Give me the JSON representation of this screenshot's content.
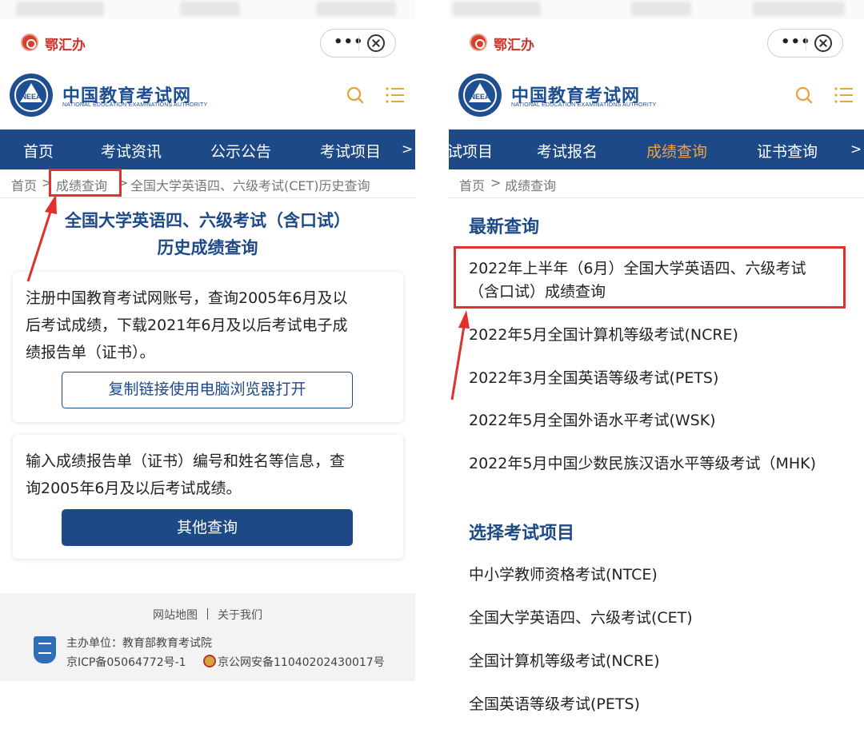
{
  "app": {
    "name": "鄂汇办",
    "capsule_more": "•••"
  },
  "site": {
    "title": "中国教育考试网",
    "subtitle": "NATIONAL EDUCATION EXAMINATIONS AUTHORITY",
    "logo_text": "NEEA"
  },
  "left": {
    "nav": [
      "首页",
      "考试资讯",
      "公示公告",
      "考试项目",
      ">"
    ],
    "breadcrumb": {
      "home": "首页",
      "sep1": ">",
      "current": "成绩查询",
      "sep2": ">",
      "page": "全国大学英语四、六级考试(CET)历史查询"
    },
    "heading_line1": "全国大学英语四、六级考试（含口试）",
    "heading_line2": "历史成绩查询",
    "card1": {
      "line1": "注册中国教育考试网账号，查询2005年6月及以",
      "line2": "后考试成绩，下载2021年6月及以后考试电子成",
      "line3": "绩报告单（证书）。",
      "button": "复制链接使用电脑浏览器打开"
    },
    "card2": {
      "line1": "输入成绩报告单（证书）编号和姓名等信息，查",
      "line2": "询2005年6月及以后考试成绩。",
      "button": "其他查询"
    },
    "footer": {
      "sitemap": "网站地图",
      "about": "关于我们",
      "host": "主办单位：教育部教育考试院",
      "icp": "京ICP备05064772号-1",
      "police": "京公网安备11040202430017号"
    }
  },
  "right": {
    "nav": [
      "试项目",
      "考试报名",
      "成绩查询",
      "证书查询",
      ">"
    ],
    "breadcrumb": {
      "home": "首页",
      "sep1": ">",
      "current": "成绩查询"
    },
    "latest_title": "最新查询",
    "latest": [
      {
        "line1": "2022年上半年（6月）全国大学英语四、六级考试",
        "line2": "（含口试）成绩查询"
      },
      {
        "line1": "2022年5月全国计算机等级考试(NCRE)"
      },
      {
        "line1": "2022年3月全国英语等级考试(PETS)"
      },
      {
        "line1": "2022年5月全国外语水平考试(WSK)"
      },
      {
        "line1": "2022年5月中国少数民族汉语水平等级考试（MHK)"
      }
    ],
    "select_title": "选择考试项目",
    "projects": [
      "中小学教师资格考试(NTCE)",
      "全国大学英语四、六级考试(CET)",
      "全国计算机等级考试(NCRE)",
      "全国英语等级考试(PETS)"
    ]
  },
  "colors": {
    "brand_blue": "#1d4a87",
    "highlight_orange": "#f0a14b",
    "annotation_red": "#e0322b"
  }
}
